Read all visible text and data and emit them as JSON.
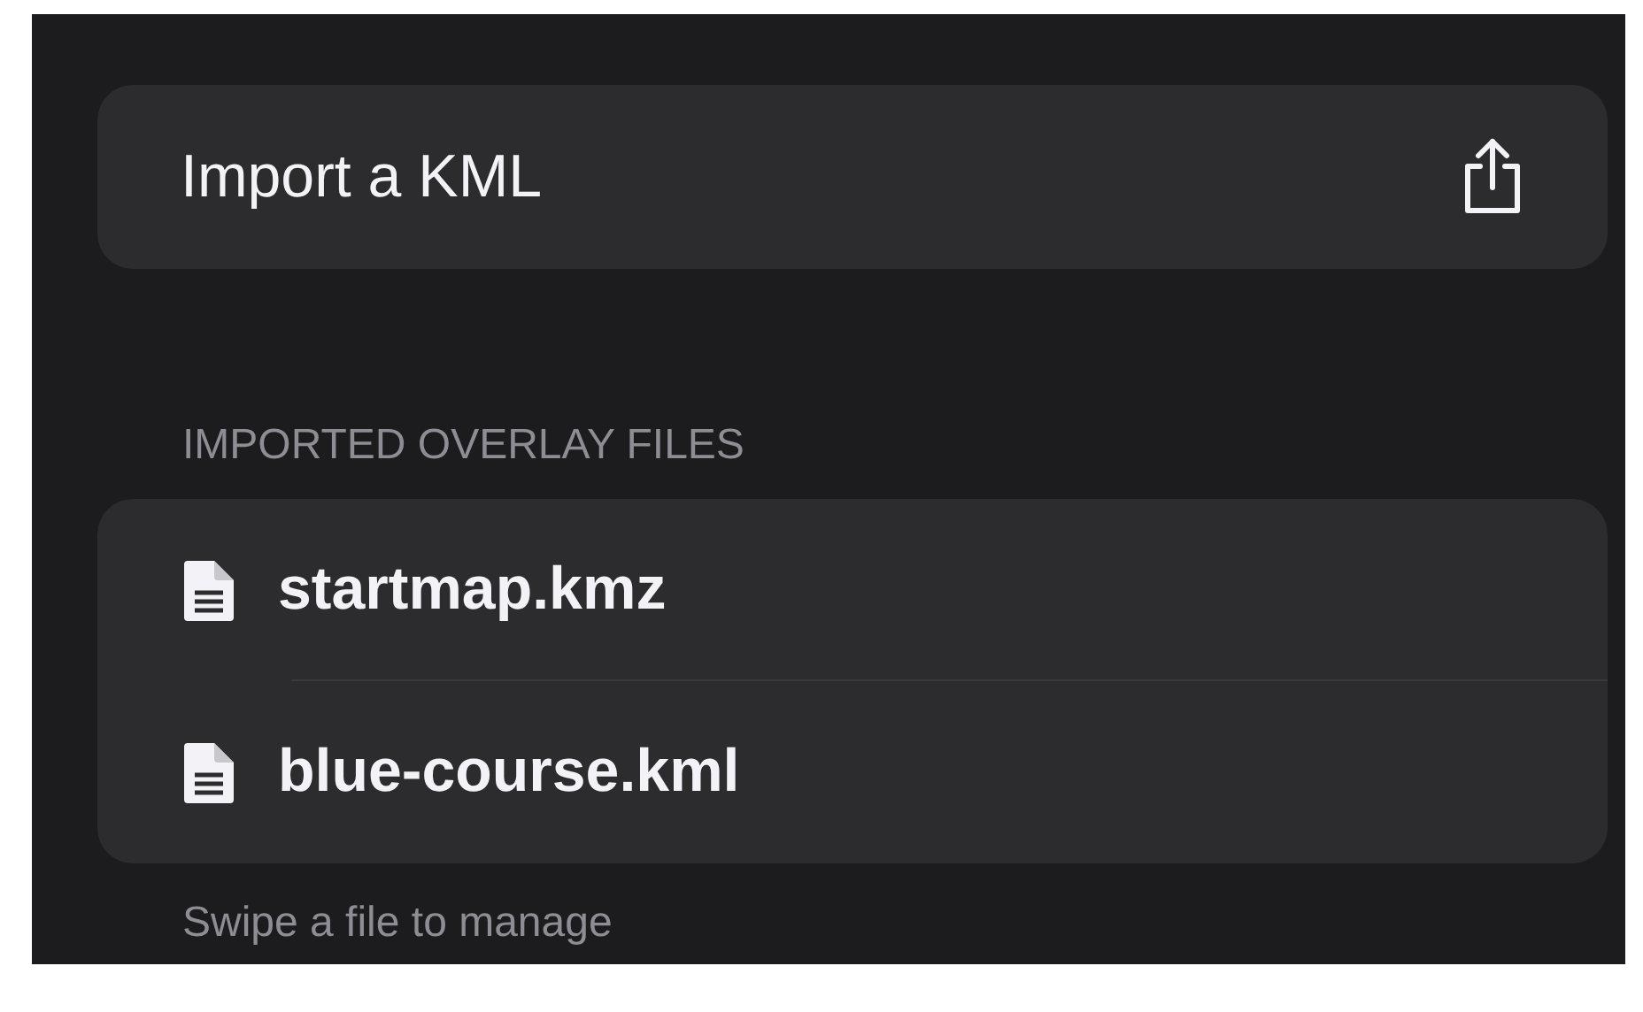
{
  "import_row": {
    "label": "Import a KML"
  },
  "section": {
    "header": "IMPORTED OVERLAY FILES",
    "files": [
      {
        "name": "startmap.kmz"
      },
      {
        "name": "blue-course.kml"
      }
    ],
    "footer": "Swipe a file to manage"
  }
}
